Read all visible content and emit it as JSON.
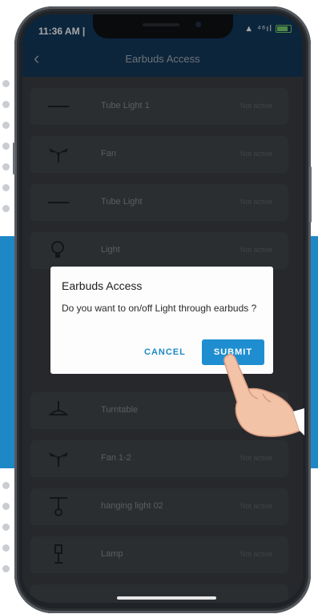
{
  "status_bar": {
    "time": "11:36 AM | ",
    "icons": "▲ ⁴⁶ıl"
  },
  "app_bar": {
    "title": "Earbuds Access",
    "back_icon": "chevron-left-icon"
  },
  "devices": [
    {
      "name": "Tube Light 1",
      "status": "Not active",
      "icon": "tube-light-icon"
    },
    {
      "name": "Fan",
      "status": "Not active",
      "icon": "fan-icon"
    },
    {
      "name": "Tube Light",
      "status": "Not active",
      "icon": "tube-light-icon"
    },
    {
      "name": "Light",
      "status": "Not active",
      "icon": "bulb-icon"
    },
    {
      "name": "Turntable",
      "status": "",
      "icon": "ceiling-light-icon"
    },
    {
      "name": "Fan 1-2",
      "status": "Not active",
      "icon": "fan-icon"
    },
    {
      "name": "hanging light 02",
      "status": "Not active",
      "icon": "hanging-light-icon"
    },
    {
      "name": "Lamp",
      "status": "Not active",
      "icon": "lamp-icon"
    }
  ],
  "dialog": {
    "title": "Earbuds Access",
    "message": "Do you want to on/off Light through earbuds ?",
    "cancel_label": "CANCEL",
    "submit_label": "SUBMIT"
  },
  "colors": {
    "accent": "#1e88c7",
    "app_bar": "#143a5b",
    "dialog_bg": "#fdfdfd"
  }
}
